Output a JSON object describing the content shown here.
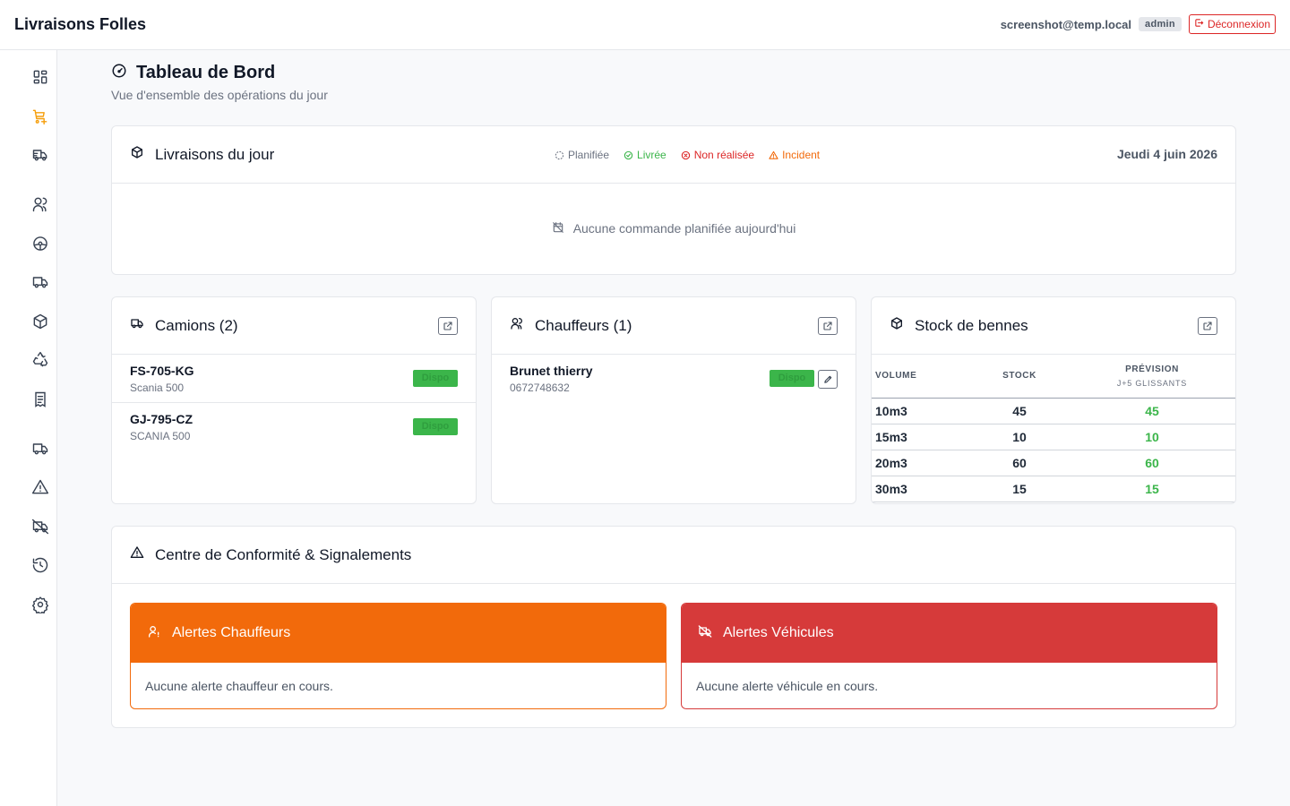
{
  "app": {
    "title": "Livraisons Folles"
  },
  "user": {
    "email": "screenshot@temp.local",
    "role": "admin",
    "logout_label": "Déconnexion"
  },
  "sidebar": {
    "items": [
      {
        "icon": "dashboard-icon"
      },
      {
        "icon": "cart-plus-icon",
        "active": true
      },
      {
        "icon": "truck-fast-icon"
      },
      {
        "icon": "users-icon"
      },
      {
        "icon": "steering-wheel-icon"
      },
      {
        "icon": "truck-icon"
      },
      {
        "icon": "box-icon"
      },
      {
        "icon": "recycle-icon"
      },
      {
        "icon": "receipt-icon"
      },
      {
        "icon": "truck-icon"
      },
      {
        "icon": "warning-icon"
      },
      {
        "icon": "truck-off-icon"
      },
      {
        "icon": "history-icon"
      },
      {
        "icon": "settings-icon"
      }
    ]
  },
  "page": {
    "title": "Tableau de Bord",
    "subtitle": "Vue d'ensemble des opérations du jour"
  },
  "deliveries": {
    "title": "Livraisons du jour",
    "legend": {
      "planned": "Planifiée",
      "delivered": "Livrée",
      "not_done": "Non réalisée",
      "incident": "Incident"
    },
    "date": "Jeudi 4 juin 2026",
    "empty": "Aucune commande planifiée aujourd'hui"
  },
  "trucks": {
    "title": "Camions (2)",
    "rows": [
      {
        "plate": "FS-705-KG",
        "model": "Scania 500",
        "status": "Dispo"
      },
      {
        "plate": "GJ-795-CZ",
        "model": "SCANIA 500",
        "status": "Dispo"
      }
    ]
  },
  "drivers": {
    "title": "Chauffeurs (1)",
    "rows": [
      {
        "name": "Brunet thierry",
        "phone": "0672748632",
        "status": "Dispo"
      }
    ]
  },
  "stock": {
    "title": "Stock de bennes",
    "headers": {
      "volume": "Volume",
      "stock": "Stock",
      "forecast": "Prévision",
      "forecast_sub": "J+5 glissants"
    },
    "rows": [
      {
        "volume": "10m3",
        "stock": "45",
        "forecast": "45"
      },
      {
        "volume": "15m3",
        "stock": "10",
        "forecast": "10"
      },
      {
        "volume": "20m3",
        "stock": "60",
        "forecast": "60"
      },
      {
        "volume": "30m3",
        "stock": "15",
        "forecast": "15"
      }
    ]
  },
  "compliance": {
    "title": "Centre de Conformité & Signalements",
    "driver_alerts": {
      "title": "Alertes Chauffeurs",
      "empty": "Aucune alerte chauffeur en cours."
    },
    "vehicle_alerts": {
      "title": "Alertes Véhicules",
      "empty": "Aucune alerte véhicule en cours."
    }
  },
  "colors": {
    "accent": "#f59e0b",
    "orange": "#f26a0b",
    "red": "#d63a3a",
    "green": "#3bb54a",
    "gray": "#6b7280"
  }
}
